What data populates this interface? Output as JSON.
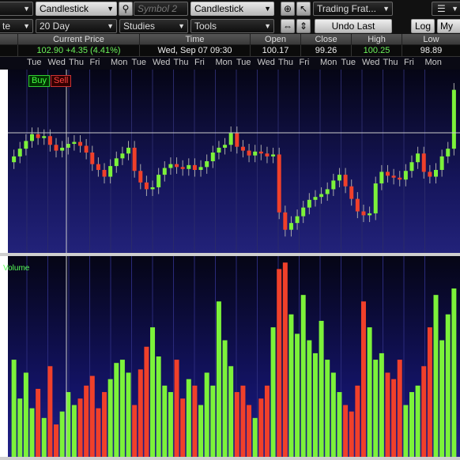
{
  "toolbar": {
    "symbol1_value": "",
    "chart_type_1": "Candlestick",
    "symbol2_placeholder": "Symbol 2",
    "chart_type_2": "Candlestick",
    "layout_select": "Trading Frat...",
    "menu_icon": "list-icon",
    "period": "20 Day",
    "studies": "Studies",
    "tools": "Tools",
    "undo_label": "Undo Last",
    "log_label": "Log",
    "my_label": "My C",
    "left_clip_1": "",
    "left_clip_2": "te"
  },
  "quote_header": [
    "Current Price",
    "Time",
    "Open",
    "Close",
    "High",
    "Low"
  ],
  "quote": {
    "current_price": "102.90",
    "change": "+4.35 (4.41%)",
    "time": "Wed, Sep 07  09:30",
    "open": "100.17",
    "close": "99.26",
    "high": "100.25",
    "low": "98.89"
  },
  "day_labels": [
    "Tue",
    "Wed",
    "Thu",
    "Fri",
    "Mon",
    "Tue",
    "Wed",
    "Thu",
    "Fri",
    "Mon",
    "Tue",
    "Wed",
    "Thu",
    "Fri",
    "Mon",
    "Tue",
    "Wed",
    "Thu",
    "Fri",
    "Mon"
  ],
  "trade_buttons": {
    "buy": "Buy",
    "sell": "Sell"
  },
  "volume_label": "Volume",
  "colors": {
    "up": "#7cf23a",
    "down": "#f0402a",
    "accent_green": "#6bf25a"
  },
  "chart_data": {
    "type": "candlestick",
    "price_closes": [
      96.0,
      96.8,
      97.6,
      98.3,
      97.9,
      98.1,
      97.2,
      96.6,
      96.9,
      97.3,
      97.5,
      97.1,
      96.4,
      95.2,
      94.6,
      93.9,
      95.0,
      95.8,
      96.3,
      96.9,
      94.5,
      93.3,
      92.6,
      92.8,
      94.1,
      94.8,
      95.2,
      94.9,
      94.7,
      95.1,
      94.6,
      94.9,
      95.5,
      96.4,
      96.9,
      97.2,
      98.4,
      97.0,
      96.6,
      96.1,
      96.5,
      96.3,
      96.0,
      96.2,
      90.2,
      88.4,
      89.1,
      89.8,
      90.7,
      91.5,
      91.8,
      92.1,
      92.6,
      93.5,
      94.1,
      92.9,
      91.6,
      90.3,
      89.9,
      90.1,
      93.2,
      94.4,
      94.0,
      93.8,
      93.6,
      94.5,
      95.4,
      96.3,
      94.4,
      93.9,
      94.6,
      96.0,
      96.8,
      102.9
    ],
    "volumes": [
      30,
      18,
      26,
      15,
      21,
      12,
      28,
      10,
      14,
      20,
      16,
      18,
      22,
      25,
      15,
      20,
      24,
      29,
      30,
      26,
      16,
      27,
      34,
      40,
      31,
      22,
      20,
      30,
      18,
      24,
      22,
      16,
      26,
      22,
      48,
      36,
      28,
      20,
      22,
      16,
      12,
      18,
      22,
      40,
      58,
      60,
      44,
      38,
      50,
      36,
      32,
      42,
      30,
      26,
      20,
      16,
      14,
      22,
      48,
      40,
      30,
      32,
      26,
      24,
      30,
      16,
      20,
      22,
      28,
      40,
      50,
      36,
      44,
      52
    ]
  }
}
